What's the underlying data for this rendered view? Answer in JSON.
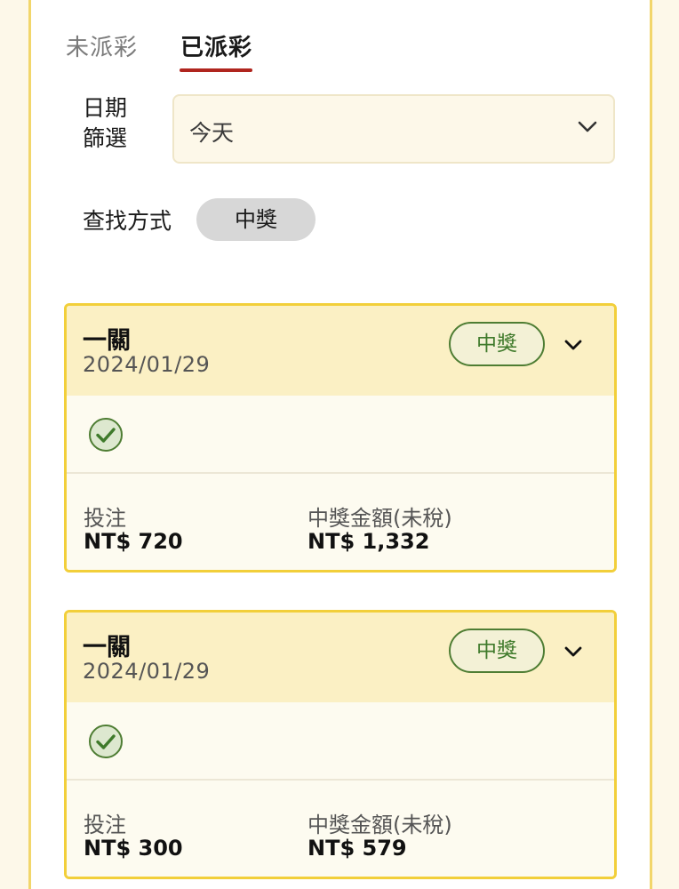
{
  "tabs": [
    {
      "label": "未派彩",
      "active": false
    },
    {
      "label": "已派彩",
      "active": true
    }
  ],
  "filter": {
    "date_label": "日期篩選",
    "date_value": "今天",
    "search_label": "查找方式",
    "search_chip": "中獎"
  },
  "tickets": [
    {
      "title": "一關",
      "date": "2024/01/29",
      "badge": "中獎",
      "bet_label": "投注",
      "bet_value": "NT$ 720",
      "win_label": "中獎金額(未稅)",
      "win_value": "NT$ 1,332"
    },
    {
      "title": "一關",
      "date": "2024/01/29",
      "badge": "中獎",
      "bet_label": "投注",
      "bet_value": "NT$ 300",
      "win_label": "中獎金額(未稅)",
      "win_value": "NT$ 579"
    }
  ],
  "colors": {
    "accent_red": "#b0251e",
    "card_border": "#f2cf3a",
    "win_green": "#4e7d33"
  },
  "icons": {
    "select_chevron": "chevron-down-icon",
    "card_chevron": "chevron-down-icon",
    "status": "check-circle-icon"
  }
}
